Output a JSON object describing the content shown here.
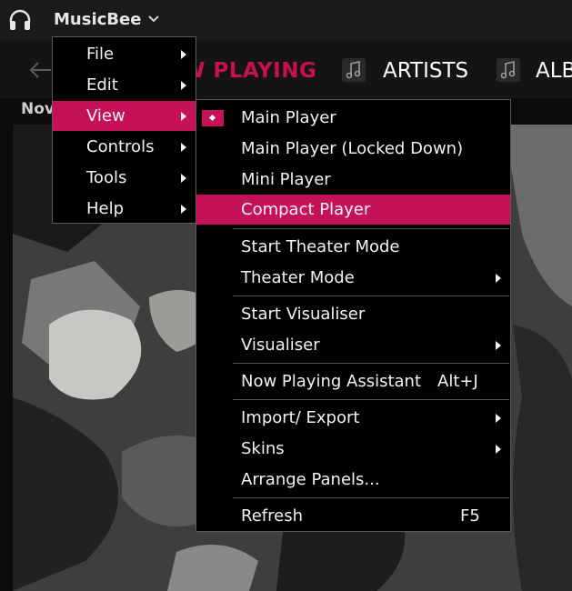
{
  "app": {
    "title": "MusicBee"
  },
  "nav": {
    "now_playing_label": "W PLAYING",
    "artists_label": "ARTISTS",
    "albums_label": "ALB"
  },
  "panel": {
    "now_label": "Nov"
  },
  "main_menu": {
    "items": [
      {
        "label": "File",
        "has_submenu": true
      },
      {
        "label": "Edit",
        "has_submenu": true
      },
      {
        "label": "View",
        "has_submenu": true,
        "highlighted": true
      },
      {
        "label": "Controls",
        "has_submenu": true
      },
      {
        "label": "Tools",
        "has_submenu": true
      },
      {
        "label": "Help",
        "has_submenu": true
      }
    ]
  },
  "view_menu": {
    "items": [
      {
        "label": "Main Player",
        "checked": true
      },
      {
        "label": "Main Player (Locked Down)"
      },
      {
        "label": "Mini Player"
      },
      {
        "label": "Compact Player",
        "highlighted": true
      },
      {
        "label": "Start Theater Mode"
      },
      {
        "label": "Theater Mode",
        "has_submenu": true
      },
      {
        "label": "Start Visualiser"
      },
      {
        "label": "Visualiser",
        "has_submenu": true
      },
      {
        "label": "Now Playing Assistant",
        "shortcut": "Alt+J"
      },
      {
        "label": "Import/ Export",
        "has_submenu": true
      },
      {
        "label": "Skins",
        "has_submenu": true
      },
      {
        "label": "Arrange Panels..."
      },
      {
        "label": "Refresh",
        "shortcut": "F5"
      }
    ]
  },
  "colors": {
    "accent": "#c5105a",
    "menu_bg": "#000000",
    "titlebar": "#1a1a1a"
  }
}
